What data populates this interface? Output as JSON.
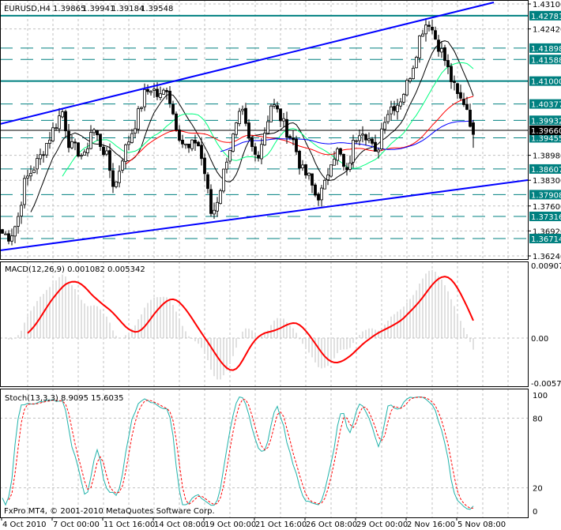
{
  "header": {
    "symbol_tf": "EURUSD,H4",
    "open": "1.39865",
    "high": "1.39941",
    "low": "1.39184",
    "close": "1.39548"
  },
  "macd_label": "MACD(12,26,9) 0.001082 0.005342",
  "stoch_label": "Stoch(13,3,3) 8.9095 15.6035",
  "copyright": "FxPro MT4, © 2001-2010 MetaQuotes Software Corp.",
  "colors": {
    "level_line": "#008080",
    "trend_line": "#0000ff",
    "ma_fast": "#000000",
    "ma_mid": "#00ff7f",
    "ma_slow": "#ff0000",
    "ma_long": "#0000ff",
    "macd_hist": "#c0c0c0",
    "macd_signal": "#ff0000",
    "stoch_k": "#20b2aa",
    "stoch_d": "#ff0000"
  },
  "price_axis": [
    "1.43100",
    "1.42420",
    "1.38980",
    "1.38300",
    "1.37600",
    "1.36920",
    "1.36240"
  ],
  "level_labels": [
    "1.42781",
    "1.41898",
    "1.41588",
    "1.41000",
    "1.40377",
    "1.39932",
    "1.39455",
    "1.38607",
    "1.37908",
    "1.37316",
    "1.36714"
  ],
  "current_price": "1.39660",
  "macd_axis": [
    "0.00907",
    "0.00",
    "-0.00575"
  ],
  "stoch_axis": [
    "100",
    "80",
    "20",
    "0"
  ],
  "time_axis": [
    "4 Oct 2010",
    "7 Oct 00:00",
    "11 Oct 16:00",
    "14 Oct 08:00",
    "19 Oct 00:00",
    "21 Oct 16:00",
    "26 Oct 08:00",
    "29 Oct 00:00",
    "2 Nov 16:00",
    "5 Nov 08:00"
  ],
  "chart_data": {
    "type": "candlestick",
    "symbol": "EURUSD",
    "timeframe": "H4",
    "ylim": [
      1.3624,
      1.431
    ],
    "close_path": [
      1.3686,
      1.3676,
      1.3719,
      1.3826,
      1.3858,
      1.3891,
      1.3934,
      1.3977,
      1.402,
      1.3923,
      1.3912,
      1.3891,
      1.3977,
      1.3934,
      1.3891,
      1.3805,
      1.3891,
      1.3944,
      1.3998,
      1.4063,
      1.4084,
      1.4052,
      1.4084,
      1.3998,
      1.3934,
      1.3912,
      1.3944,
      1.3858,
      1.3729,
      1.3794,
      1.3891,
      1.3955,
      1.402,
      1.3934,
      1.3891,
      1.3955,
      1.4041,
      1.4009,
      1.3966,
      1.3934,
      1.3858,
      1.3837,
      1.3783,
      1.3805,
      1.3891,
      1.3912,
      1.3837,
      1.3934,
      1.3977,
      1.3944,
      1.3891,
      1.3998,
      1.403,
      1.4041,
      1.4084,
      1.4149,
      1.4235,
      1.4267,
      1.4213,
      1.417,
      1.4106,
      1.4052,
      1.4041,
      1.3955
    ],
    "solid_levels": [
      1.42781,
      1.41
    ],
    "dashed_levels": [
      1.41898,
      1.41588,
      1.40377,
      1.39932,
      1.39455,
      1.38607,
      1.37908,
      1.37316,
      1.36714
    ],
    "macd": {
      "params": "12,26,9",
      "main": 0.001082,
      "signal": 0.005342,
      "ylim": [
        -0.00575,
        0.00907
      ]
    },
    "stochastic": {
      "params": "13,3,3",
      "k": 8.9095,
      "d": 15.6035,
      "levels": [
        20,
        80
      ],
      "ylim": [
        0,
        100
      ]
    },
    "grid": true
  }
}
